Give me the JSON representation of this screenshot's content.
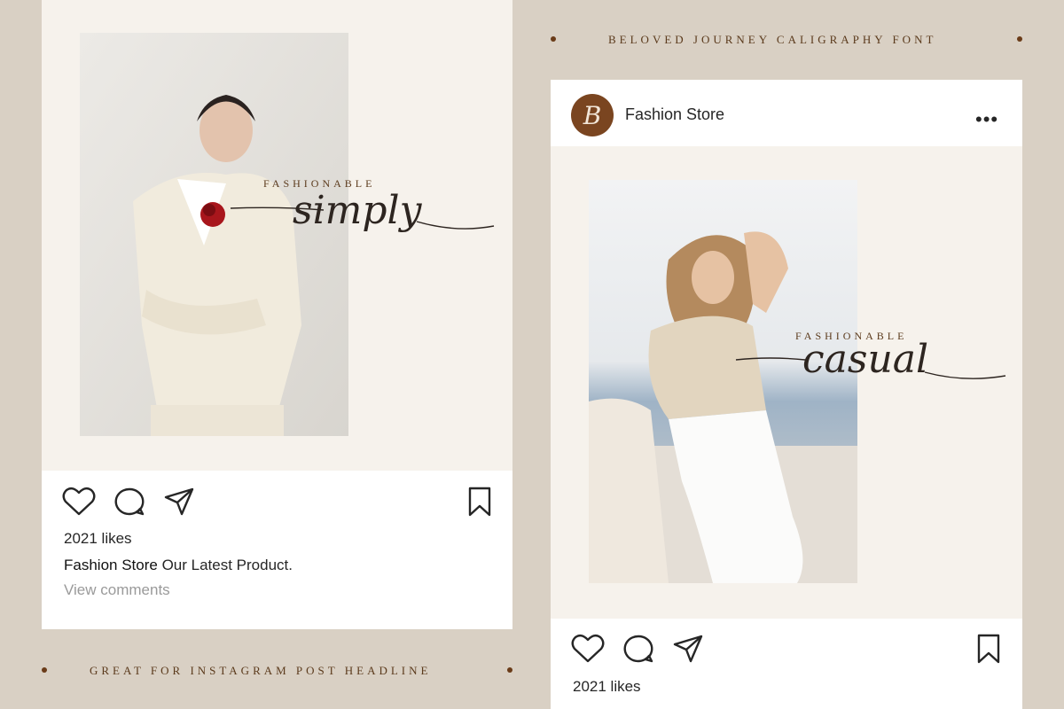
{
  "banner_top": {
    "text": "BELOVED JOURNEY CALIGRAPHY FONT"
  },
  "banner_bottom": {
    "text": "GREAT FOR INSTAGRAM POST HEADLINE"
  },
  "post_left": {
    "headline_small": "FASHIONABLE",
    "headline_script": "simply",
    "likes": "2021 likes",
    "caption_user": "Fashion Store",
    "caption_text": " Our Latest Product.",
    "comments": "View comments",
    "icons": [
      "heart-icon",
      "comment-icon",
      "send-icon",
      "bookmark-icon"
    ]
  },
  "post_right": {
    "account_name": "Fashion Store",
    "avatar_letter": "B",
    "more": "•••",
    "headline_small": "FASHIONABLE",
    "headline_script": "casual",
    "likes": "2021 likes",
    "icons": [
      "heart-icon",
      "comment-icon",
      "send-icon",
      "bookmark-icon"
    ]
  },
  "colors": {
    "background": "#d9d0c4",
    "card": "#f6f2ec",
    "accent_brown": "#6a3b18"
  }
}
